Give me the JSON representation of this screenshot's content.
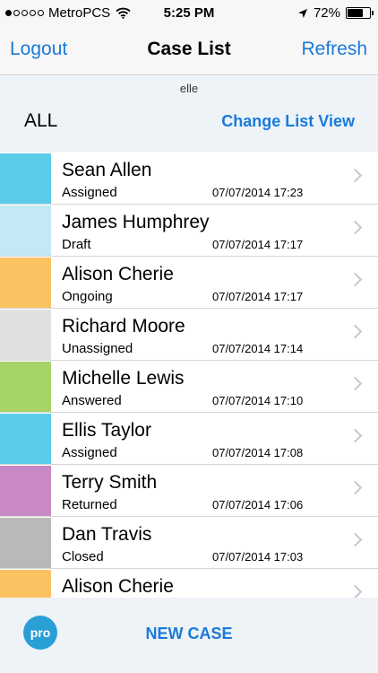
{
  "status_bar": {
    "carrier": "MetroPCS",
    "time": "5:25 PM",
    "battery_percent": "72%",
    "battery_level": 0.72,
    "signal_bars_filled": 1,
    "signal_bars_total": 5
  },
  "navbar": {
    "left_button": "Logout",
    "title": "Case List",
    "right_button": "Refresh"
  },
  "subheader": {
    "user": "elle",
    "filter": "ALL",
    "change_view": "Change List View"
  },
  "cases": [
    {
      "name": "Sean Allen",
      "status": "Assigned",
      "timestamp": "07/07/2014 17:23",
      "color": "#5bcbea"
    },
    {
      "name": "James Humphrey",
      "status": "Draft",
      "timestamp": "07/07/2014 17:17",
      "color": "#c4e9f6"
    },
    {
      "name": "Alison Cherie",
      "status": "Ongoing",
      "timestamp": "07/07/2014 17:17",
      "color": "#fbc262"
    },
    {
      "name": "Richard Moore",
      "status": "Unassigned",
      "timestamp": "07/07/2014 17:14",
      "color": "#e0e0e0"
    },
    {
      "name": "Michelle Lewis",
      "status": "Answered",
      "timestamp": "07/07/2014 17:10",
      "color": "#a6d469"
    },
    {
      "name": "Ellis Taylor",
      "status": "Assigned",
      "timestamp": "07/07/2014 17:08",
      "color": "#5bcbea"
    },
    {
      "name": "Terry Smith",
      "status": "Returned",
      "timestamp": "07/07/2014 17:06",
      "color": "#c889c5"
    },
    {
      "name": "Dan Travis",
      "status": "Closed",
      "timestamp": "07/07/2014 17:03",
      "color": "#b9b9b9"
    },
    {
      "name": "Alison Cherie",
      "status": "",
      "timestamp": "",
      "color": "#fbc262"
    }
  ],
  "bottom_bar": {
    "badge": "pro",
    "new_case": "NEW CASE"
  },
  "icons": {
    "wifi": "wifi-icon",
    "location": "location-arrow-icon",
    "battery": "battery-icon",
    "chevron": "chevron-right-icon"
  }
}
